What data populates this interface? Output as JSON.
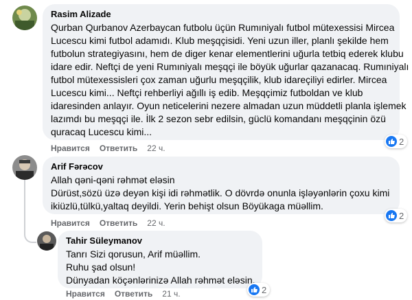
{
  "comments": [
    {
      "author": "Rasim Alizade",
      "lines": [
        "Qurban Qurbanov Azerbaycan futbolu üçün Rumıniyalı futbol mütexessisi Mircea",
        "Lucescu kimi futbol adamıdı. Klub meşqçisidi. Yeni uzun iller, planlı şekilde hem",
        "futbolun strategiyasını, hem de diger kenar elementlerini uğurla tetbiq ederek klubu",
        "idare edir. Neftçi de yeni Rumıniyalı meşqçi ile böyük uğurlar qazanacaq. Rumıniyalı",
        "futbol mütexessisleri çox zaman uğurlu meşqçilik, klub idareçiliyi edirler. Mircea",
        "Lucescu kimi... Neftçi rehberliyi ağıllı iş edib. Meşqçimiz futboldan ve klub",
        "idaresinden anlayır. Oyun neticelerini nezere almadan uzun müddetli planla işlemek",
        "lazımdı bu meşqçi ile. İlk 2 sezon sebr edilsin, güclü komandanı meşqçinin özü",
        "quracaq Lucescu kimi..."
      ],
      "like_label": "Нравится",
      "reply_label": "Ответить",
      "time": "22 ч.",
      "reactions": "2"
    },
    {
      "author": "Arif Fərəcov",
      "lines": [
        "Allah qəni-qəni rəhmət eləsin",
        "Dürüst,sözü üzə deyən kişi idi rəhmətlik. O dövrdə onunla işləyənlərin çoxu kimi",
        "ikiüzlü,tülkü,yaltaq deyildi. Yerin behişt olsun Böyükaga müəllim."
      ],
      "like_label": "Нравится",
      "reply_label": "Ответить",
      "time": "22 ч.",
      "reactions": "2"
    },
    {
      "author": "Tahir Süleymanov",
      "lines": [
        "Tanrı Sizi qorusun, Arif müəllim.",
        "Ruhu şad olsun!",
        "Dünyadan köçənlərinizə Allah rəhmət eləsin."
      ],
      "like_label": "Нравится",
      "reply_label": "Ответить",
      "time": "21 ч.",
      "reactions": "2"
    }
  ],
  "colors": {
    "bubble": "#f0f2f5",
    "meta": "#65676b",
    "like": "#1877f2"
  },
  "icons": [
    "like-icon",
    "avatar"
  ]
}
